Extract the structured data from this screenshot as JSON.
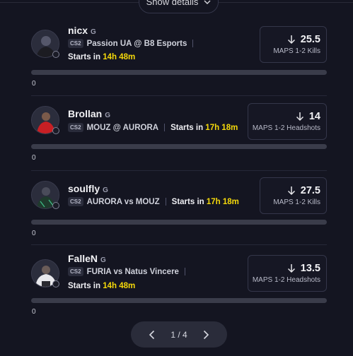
{
  "header": {
    "show_details_label": "Show details"
  },
  "picks": [
    {
      "player": "nicx",
      "tag": "G",
      "game": "CS2",
      "match": "Passion UA @ B8 Esports",
      "starts_prefix": "Starts in",
      "starts_time": "14h 48m",
      "direction": "down",
      "line": "25.5",
      "stat": "MAPS 1-2 Kills",
      "progress_value": "0",
      "progress_fraction": 0,
      "jersey_color": "#1c1c22"
    },
    {
      "player": "Brollan",
      "tag": "G",
      "game": "CS2",
      "match": "MOUZ @ AURORA",
      "starts_prefix": "Starts in",
      "starts_time": "17h 18m",
      "direction": "down",
      "line": "14",
      "stat": "MAPS 1-2 Headshots",
      "progress_value": "0",
      "progress_fraction": 0,
      "jersey_color": "#c81f24"
    },
    {
      "player": "soulfly",
      "tag": "G",
      "game": "CS2",
      "match": "AURORA vs MOUZ",
      "starts_prefix": "Starts in",
      "starts_time": "17h 18m",
      "direction": "down",
      "line": "27.5",
      "stat": "MAPS 1-2 Kills",
      "progress_value": "0",
      "progress_fraction": 0,
      "jersey_color": "#1e3a2c"
    },
    {
      "player": "FalleN",
      "tag": "G",
      "game": "CS2",
      "match": "FURIA vs Natus Vincere",
      "starts_prefix": "Starts in",
      "starts_time": "14h 48m",
      "direction": "down",
      "line": "13.5",
      "stat": "MAPS 1-2 Headshots",
      "progress_value": "0",
      "progress_fraction": 0,
      "jersey_color": "#e8e8ec"
    }
  ],
  "pagination": {
    "label": "1 / 4",
    "prev_icon": "chevron-left-icon",
    "next_icon": "chevron-right-icon"
  },
  "colors": {
    "accent_time": "#f5d90a",
    "background": "#141521"
  }
}
